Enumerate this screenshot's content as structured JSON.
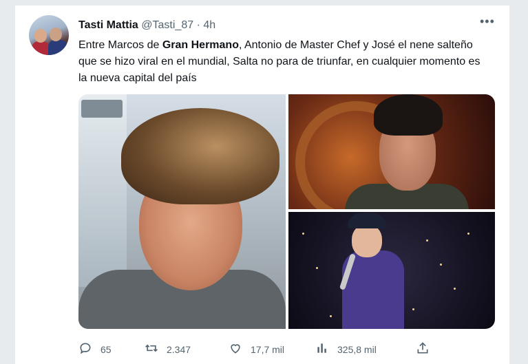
{
  "tweet": {
    "author_name": "Tasti Mattia",
    "handle": "@Tasti_87",
    "separator": "·",
    "time": "4h",
    "more_icon": "more-horizontal-icon",
    "text_before_bold": "Entre Marcos de ",
    "text_bold": "Gran Hermano",
    "text_after_bold": ", Antonio de Master Chef y José el nene salteño que se hizo viral en el mundial, Salta no para de triunfar, en cualquier momento es la nueva capital del país"
  },
  "actions": {
    "reply": {
      "icon": "reply-icon",
      "count": "65"
    },
    "retweet": {
      "icon": "retweet-icon",
      "count": "2.347"
    },
    "like": {
      "icon": "heart-icon",
      "count": "17,7 mil"
    },
    "views": {
      "icon": "analytics-icon",
      "count": "325,8 mil"
    },
    "share": {
      "icon": "share-icon"
    }
  },
  "colors": {
    "text_primary": "#0f1419",
    "text_secondary": "#536471",
    "background": "#ffffff"
  }
}
